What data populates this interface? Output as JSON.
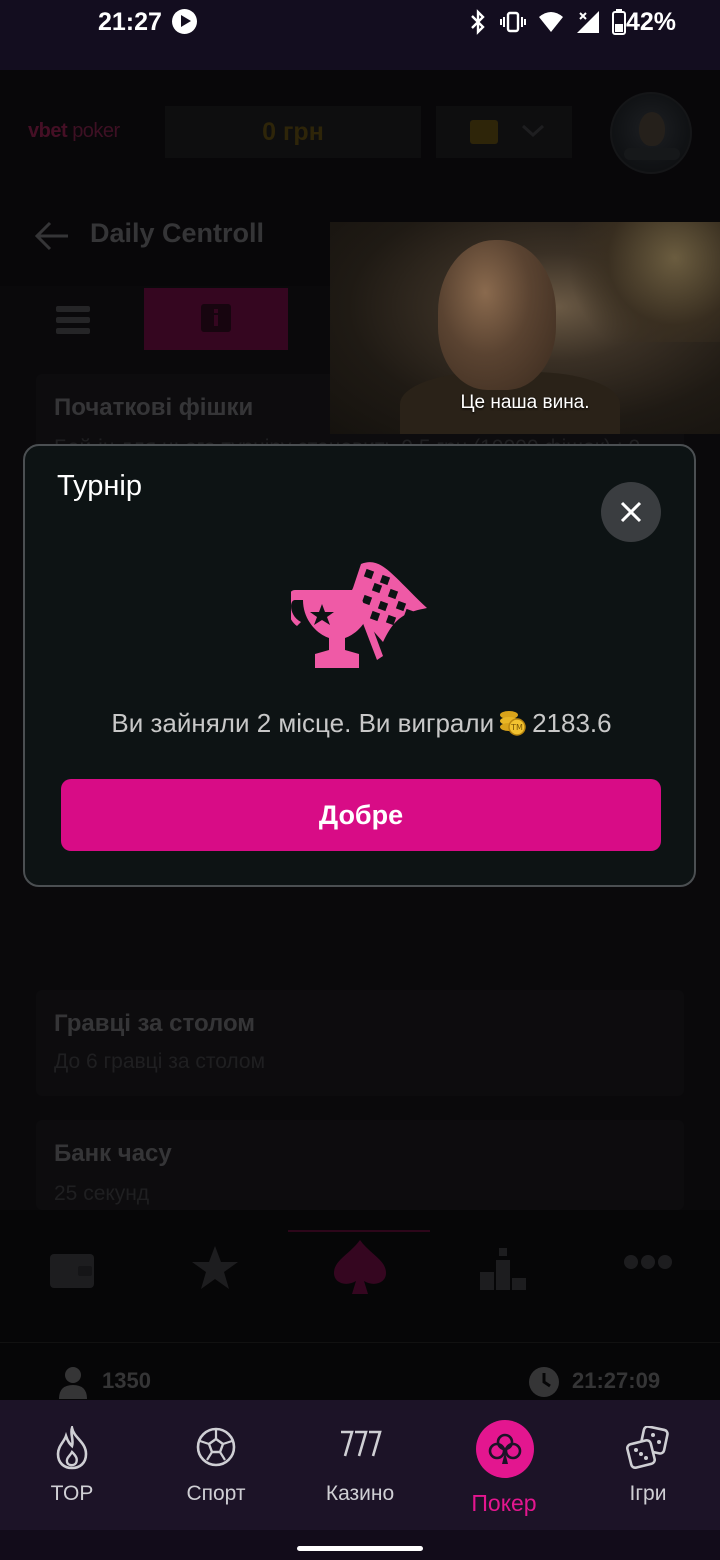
{
  "status_bar": {
    "time": "21:27",
    "battery": "42%"
  },
  "header": {
    "logo_brand": "vbet",
    "logo_suffix": "poker",
    "balance": "0 грн"
  },
  "page": {
    "title": "Daily Centroll"
  },
  "video": {
    "subtitle": "Це наша вина."
  },
  "cards": [
    {
      "title": "Початкові фішки",
      "text": "Бай-ін для цього турніру становить 0.5 грн (10000 фішок) : 0 грн йдуть до призового фонду, а 0.5 грн - це комісія турніру"
    },
    {
      "title": "Гравці за столом",
      "text": "До 6 гравці за столом"
    },
    {
      "title": "Банк часу",
      "text": "25 секунд"
    }
  ],
  "footer_stats": {
    "players": "1350",
    "clock": "21:27:09"
  },
  "modal": {
    "title": "Турнір",
    "result_text": "Ви зайняли 2 місце. Ви виграли",
    "amount": "2183.6",
    "ok_label": "Добре"
  },
  "bottom_nav": {
    "items": [
      {
        "label": "TOP",
        "icon": "flame-icon"
      },
      {
        "label": "Спорт",
        "icon": "soccer-ball-icon"
      },
      {
        "label": "Казино",
        "icon": "slot-777-icon"
      },
      {
        "label": "Покер",
        "icon": "poker-club-icon",
        "active": true
      },
      {
        "label": "Ігри",
        "icon": "dice-icon"
      }
    ]
  },
  "colors": {
    "accent": "#d80c86",
    "modal_bg": "#0d1314",
    "trophy": "#ef5aa6"
  }
}
